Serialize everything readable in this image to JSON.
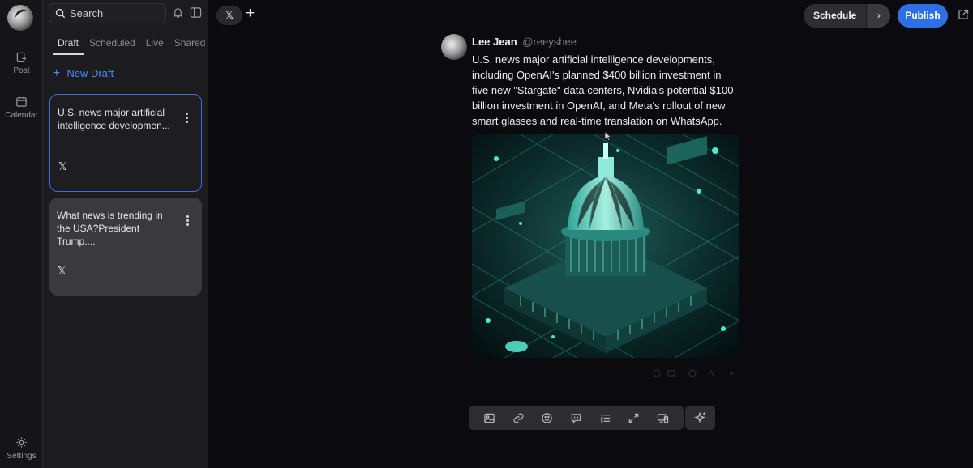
{
  "rail": {
    "items": [
      {
        "label": "Post",
        "icon": "post-icon"
      },
      {
        "label": "Calendar",
        "icon": "calendar-icon"
      },
      {
        "label": "Settings",
        "icon": "gear-icon"
      }
    ]
  },
  "panel": {
    "search_placeholder": "Search",
    "tabs": [
      "Draft",
      "Scheduled",
      "Live",
      "Shared"
    ],
    "active_tab": "Draft",
    "new_draft_label": "New Draft",
    "drafts": [
      {
        "text": "U.S. news major artificial intelligence developmen...",
        "platform": "𝕏"
      },
      {
        "text": "What news is trending in the USA?President Trump....",
        "platform": "𝕏"
      }
    ]
  },
  "topbar": {
    "platform_chip": "𝕏",
    "add_label": "+",
    "schedule_label": "Schedule",
    "schedule_more": "›",
    "publish_label": "Publish"
  },
  "post": {
    "author_name": "Lee Jean",
    "author_handle": "@reeyshee",
    "body": "U.S. news major artificial intelligence developments, including OpenAI's planned $400 billion investment in five new \"Stargate\" data centers, Nvidia's potential $100 billion investment in OpenAI, and Meta's rollout of new smart glasses and real-time translation on WhatsApp."
  },
  "toolbar": {
    "tools": [
      "image-icon",
      "link-icon",
      "emoji-icon",
      "quote-icon",
      "list-icon",
      "expand-icon",
      "preview-icon"
    ],
    "ai_tool": "sparkle-icon"
  },
  "colors": {
    "accent": "#2f6fe6",
    "link": "#4a8cf5",
    "selected_border": "#3a6fd8"
  }
}
